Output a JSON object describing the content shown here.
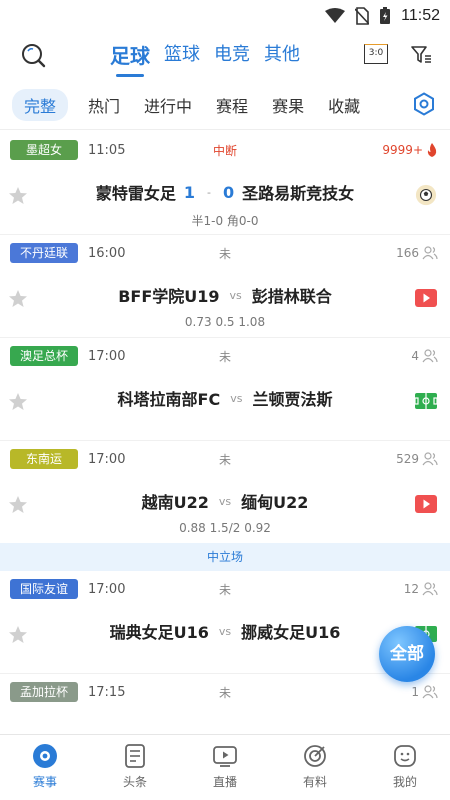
{
  "status_bar": {
    "time": "11:52"
  },
  "header": {
    "sport_tabs": [
      "足球",
      "篮球",
      "电竞",
      "其他"
    ],
    "score_icon_text": "3:0"
  },
  "sub_tabs": [
    "完整",
    "热门",
    "进行中",
    "赛程",
    "赛果",
    "收藏"
  ],
  "matches": [
    {
      "league": "墨超女",
      "league_color": "#5a9e4c",
      "time": "11:05",
      "status": "中断",
      "count": "9999+",
      "home": "蒙特雷女足",
      "away": "圣路易斯竞技女",
      "score_home": "1",
      "score_sep": "-",
      "score_away": "0",
      "odds": "半1-0 角0-0"
    },
    {
      "league": "不丹廷联",
      "league_color": "#4b78d8",
      "time": "16:00",
      "status": "未",
      "count": "166",
      "home": "BFF学院U19",
      "vs": "vs",
      "away": "彭措林联合",
      "odds": "0.73  0.5  1.08"
    },
    {
      "league": "澳足总杯",
      "league_color": "#37a84f",
      "time": "17:00",
      "status": "未",
      "count": "4",
      "home": "科塔拉南部FC",
      "vs": "vs",
      "away": "兰顿贾法斯"
    },
    {
      "league": "东南运",
      "league_color": "#b8b828",
      "time": "17:00",
      "status": "未",
      "count": "529",
      "home": "越南U22",
      "vs": "vs",
      "away": "缅甸U22",
      "odds": "0.88  1.5/2  0.92",
      "neutral": "中立场"
    },
    {
      "league": "国际友谊",
      "league_color": "#3e73d4",
      "time": "17:00",
      "status": "未",
      "count": "12",
      "home": "瑞典女足U16",
      "vs": "vs",
      "away": "挪威女足U16"
    },
    {
      "league": "孟加拉杯",
      "league_color": "#8a9a8a",
      "time": "17:15",
      "status": "未",
      "count": "1"
    }
  ],
  "fab_label": "全部",
  "bottom_nav": [
    "赛事",
    "头条",
    "直播",
    "有料",
    "我的"
  ],
  "colors": {
    "accent": "#2a7bd6",
    "live": "#e0452d"
  }
}
